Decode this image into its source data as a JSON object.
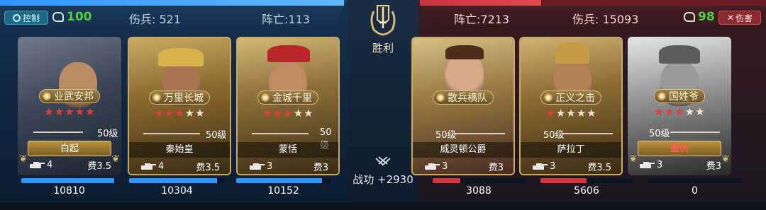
{
  "left_side": {
    "control_label": "控制",
    "energy": "100",
    "wounded": "伤兵: 521",
    "killed": "阵亡:113",
    "troop_bar_fraction": 1.0
  },
  "right_side": {
    "damage_label": "伤害",
    "energy": "98",
    "killed": "阵亡:7213",
    "wounded": "伤兵: 15093",
    "troop_bar_fraction": 0.35
  },
  "center": {
    "result": "胜利",
    "merit": "战功 +2930"
  },
  "heroes": [
    {
      "skill": "业武安邦",
      "stars_on": 5,
      "stars_total": 5,
      "level": "50级",
      "name": "白起",
      "troop": "4",
      "cost": "费3.5",
      "hp": "10810",
      "hp_fraction": 0.97,
      "injured": false
    },
    {
      "skill": "万里长城",
      "stars_on": 3,
      "stars_total": 5,
      "level": "50级",
      "name": "秦始皇",
      "troop": "4",
      "cost": "费3.5",
      "hp": "10304",
      "hp_fraction": 0.92,
      "injured": false
    },
    {
      "skill": "金城千里",
      "stars_on": 3,
      "stars_total": 5,
      "level": "50级",
      "name": "蒙恬",
      "troop": "3",
      "cost": "费3",
      "hp": "10152",
      "hp_fraction": 0.91,
      "injured": false
    },
    {
      "skill": "散兵横队",
      "stars_on": 0,
      "stars_total": 0,
      "level": "50级",
      "name": "威灵顿公爵",
      "troop": "3",
      "cost": "费3",
      "hp": "3088",
      "hp_fraction": 0.3,
      "injured": false
    },
    {
      "skill": "正义之击",
      "stars_on": 1,
      "stars_total": 5,
      "level": "50级",
      "name": "萨拉丁",
      "troop": "3",
      "cost": "费3.5",
      "hp": "5606",
      "hp_fraction": 0.5,
      "injured": false
    },
    {
      "skill": "国姓爷",
      "stars_on": 3,
      "stars_total": 5,
      "level": "50级",
      "name": "重伤",
      "troop": "3",
      "cost": "费3",
      "hp": "0",
      "hp_fraction": 0.0,
      "injured": true
    }
  ],
  "colors": {
    "ally": "#2f95ff",
    "enemy": "#d6343c",
    "gold": "#c9a862",
    "energy": "#4ed03a"
  },
  "icons": [
    "control-icon",
    "energy-icon",
    "laurel-sword-emblem",
    "merit-icon",
    "tank-icon",
    "laurel-icon",
    "close-x-icon"
  ]
}
